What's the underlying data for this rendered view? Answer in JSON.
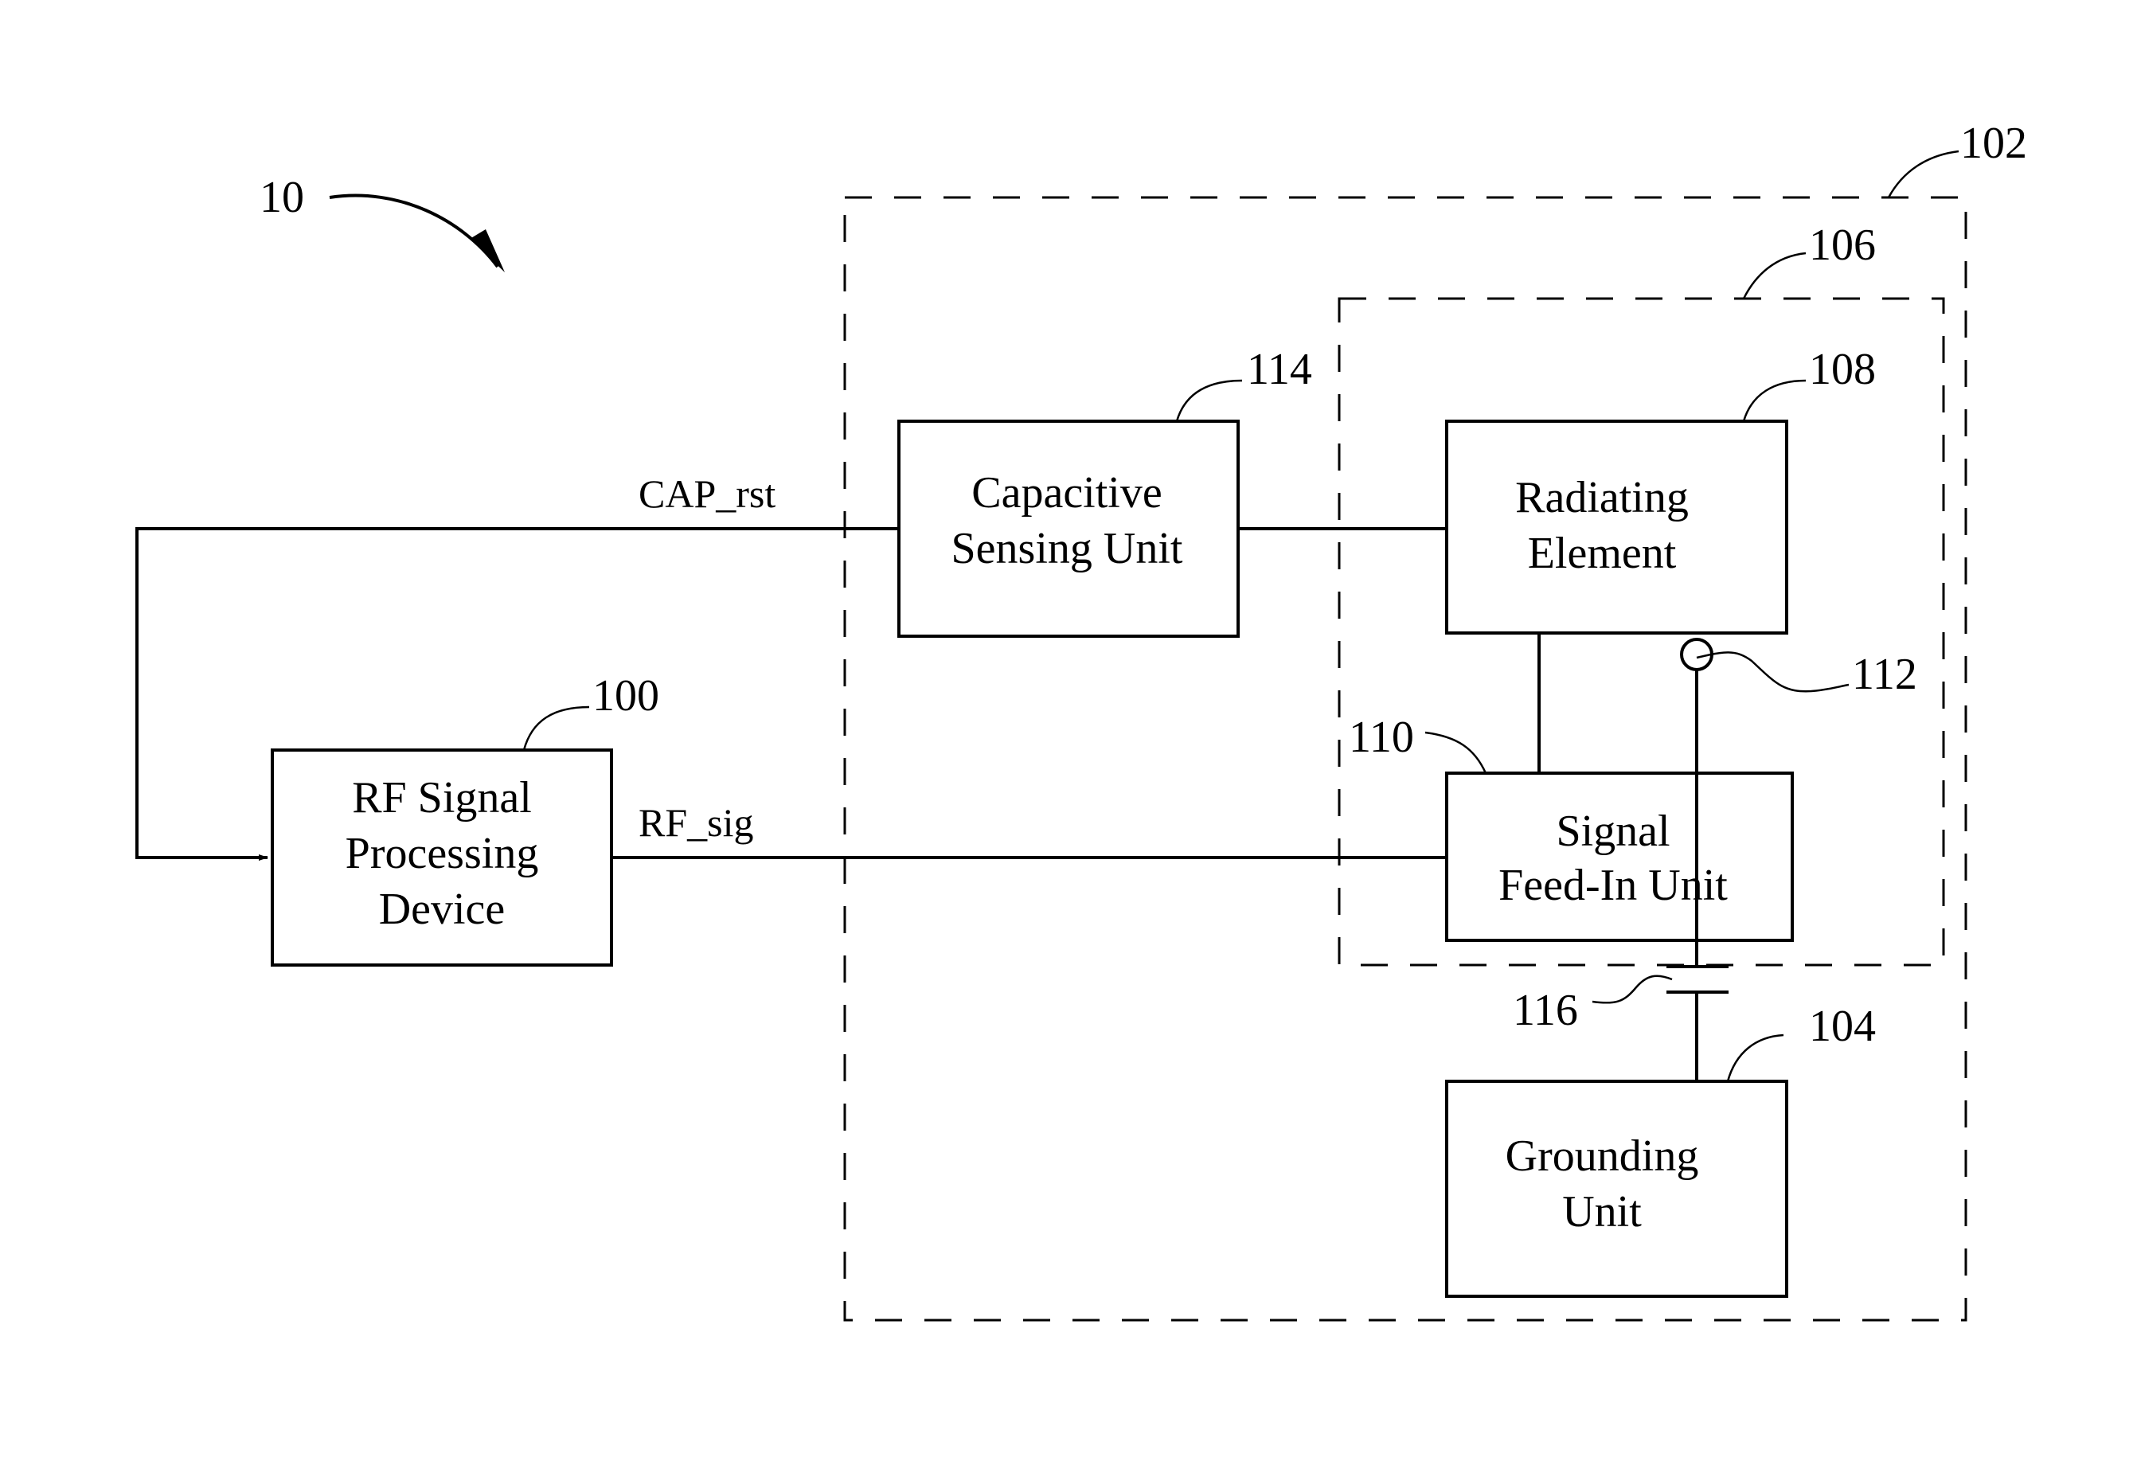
{
  "figure": {
    "ref": "10",
    "containers": {
      "antenna_module": {
        "ref": "102"
      },
      "antenna": {
        "ref": "106"
      }
    },
    "blocks": {
      "rf_device": {
        "ref": "100",
        "lines": [
          "RF Signal",
          "Processing",
          "Device"
        ]
      },
      "capacitive": {
        "ref": "114",
        "lines": [
          "Capacitive",
          "Sensing Unit"
        ]
      },
      "radiating": {
        "ref": "108",
        "lines": [
          "Radiating",
          "Element"
        ]
      },
      "feed_in": {
        "ref": "110",
        "lines": [
          "Signal",
          "Feed-In Unit"
        ]
      },
      "grounding": {
        "ref": "104",
        "lines": [
          "Grounding",
          "Unit"
        ]
      }
    },
    "components": {
      "contact_point": {
        "ref": "112"
      },
      "capacitor": {
        "ref": "116"
      }
    },
    "signals": {
      "cap_rst": "CAP_rst",
      "rf_sig": "RF_sig"
    },
    "colors": {
      "line": "#000000",
      "background": "#ffffff"
    }
  }
}
